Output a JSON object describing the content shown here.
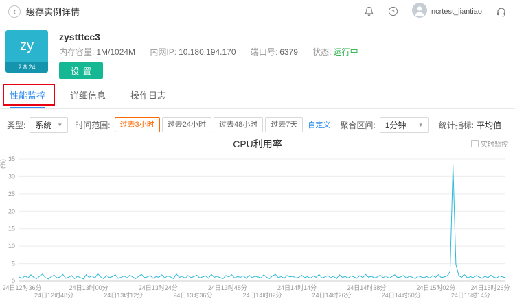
{
  "topbar": {
    "title": "缓存实例详情",
    "username": "ncrtest_liantiao"
  },
  "instance": {
    "avatar_text": "zy",
    "version": "2.8.24",
    "name": "zystttcc3",
    "fields": [
      {
        "label": "内存容量:",
        "value": "1M/1024M"
      },
      {
        "label": "内网IP:",
        "value": "10.180.194.170"
      },
      {
        "label": "端口号:",
        "value": "6379"
      },
      {
        "label": "状态:",
        "value": "运行中"
      }
    ],
    "settings_button": "设置"
  },
  "tabs": [
    {
      "label": "性能监控",
      "active": true
    },
    {
      "label": "详细信息",
      "active": false
    },
    {
      "label": "操作日志",
      "active": false
    }
  ],
  "filters": {
    "type_label": "类型:",
    "type_value": "系统",
    "range_label": "时间范围:",
    "ranges": [
      "过去3小时",
      "过去24小时",
      "过去48小时",
      "过去7天"
    ],
    "active_range": "过去3小时",
    "custom_label": "自定义",
    "agg_label": "聚合区间:",
    "agg_value": "1分钟",
    "stat_label": "统计指标:",
    "stat_value": "平均值"
  },
  "chart_ui": {
    "realtime_label": "实时监控"
  },
  "colors": {
    "accent_blue": "#2d8cf0",
    "button_green": "#16b893",
    "status_green": "#27b148",
    "active_range_orange": "#ff6a00",
    "annotation_red": "#e60012",
    "line_teal": "#2fb8d8"
  },
  "chart_data": {
    "type": "line",
    "title": "CPU利用率",
    "ylabel": "(%)",
    "ylim": [
      0,
      35
    ],
    "yticks": [
      0,
      5,
      10,
      15,
      20,
      25,
      30,
      35
    ],
    "grid": "horizontal",
    "legend": "none",
    "x_tick_labels": [
      "24日12时36分",
      "24日12时48分",
      "24日13时00分",
      "24日13时12分",
      "24日13时24分",
      "24日13时36分",
      "24日13时48分",
      "24日14时02分",
      "24日14时14分",
      "24日14时26分",
      "24日14时38分",
      "24日14时50分",
      "24日15时02分",
      "24日15时14分",
      "24日15时26分"
    ],
    "series": [
      {
        "name": "CPU利用率",
        "color": "#2fb8d8",
        "values": [
          1.2,
          0.8,
          1.5,
          0.9,
          1.8,
          1.1,
          0.7,
          1.4,
          2.0,
          1.0,
          0.6,
          1.3,
          1.7,
          0.9,
          1.2,
          1.9,
          0.8,
          1.1,
          1.6,
          0.7,
          1.4,
          1.0,
          0.6,
          1.8,
          1.1,
          1.5,
          0.9,
          2.1,
          1.2,
          0.7,
          1.6,
          1.0,
          1.3,
          1.8,
          0.8,
          1.1,
          1.5,
          0.9,
          1.7,
          1.2,
          0.7,
          1.4,
          1.9,
          1.0,
          1.2,
          1.6,
          0.8,
          1.3,
          1.1,
          1.8,
          0.9,
          1.5,
          1.2,
          0.7,
          2.0,
          1.1,
          1.4,
          0.8,
          1.6,
          1.0,
          1.3,
          1.7,
          0.9,
          1.2,
          1.5,
          0.8,
          1.9,
          1.1,
          1.4,
          1.0,
          0.7,
          1.6,
          1.2,
          1.8,
          0.9,
          1.3,
          1.1,
          1.5,
          0.8,
          1.7,
          1.0,
          1.4,
          1.2,
          0.9,
          1.8,
          1.1,
          0.7,
          1.5,
          1.9,
          1.0,
          1.3,
          0.8,
          1.6,
          1.2,
          1.4,
          0.9,
          1.1,
          1.7,
          1.0,
          1.3,
          0.8,
          1.5,
          1.1,
          1.9,
          0.9,
          1.2,
          1.6,
          1.0,
          1.4,
          0.7,
          1.8,
          1.1,
          1.3,
          0.9,
          1.5,
          1.2,
          0.8,
          1.6,
          1.0,
          1.9,
          1.1,
          1.4,
          0.9,
          1.2,
          1.7,
          1.0,
          1.5,
          0.8,
          1.3,
          1.8,
          1.0,
          1.2,
          1.6,
          0.9,
          1.4,
          1.1,
          0.7,
          1.5,
          1.2,
          1.0,
          1.3,
          0.9,
          1.6,
          1.1,
          1.8,
          1.0,
          1.2,
          1.5,
          2.7,
          33.2,
          4.8,
          1.5,
          1.1,
          1.8,
          0.9,
          1.3,
          1.0,
          1.6,
          1.2,
          0.8,
          1.4,
          1.0,
          1.7,
          1.1,
          0.9,
          1.5,
          1.2,
          1.0
        ]
      }
    ]
  }
}
